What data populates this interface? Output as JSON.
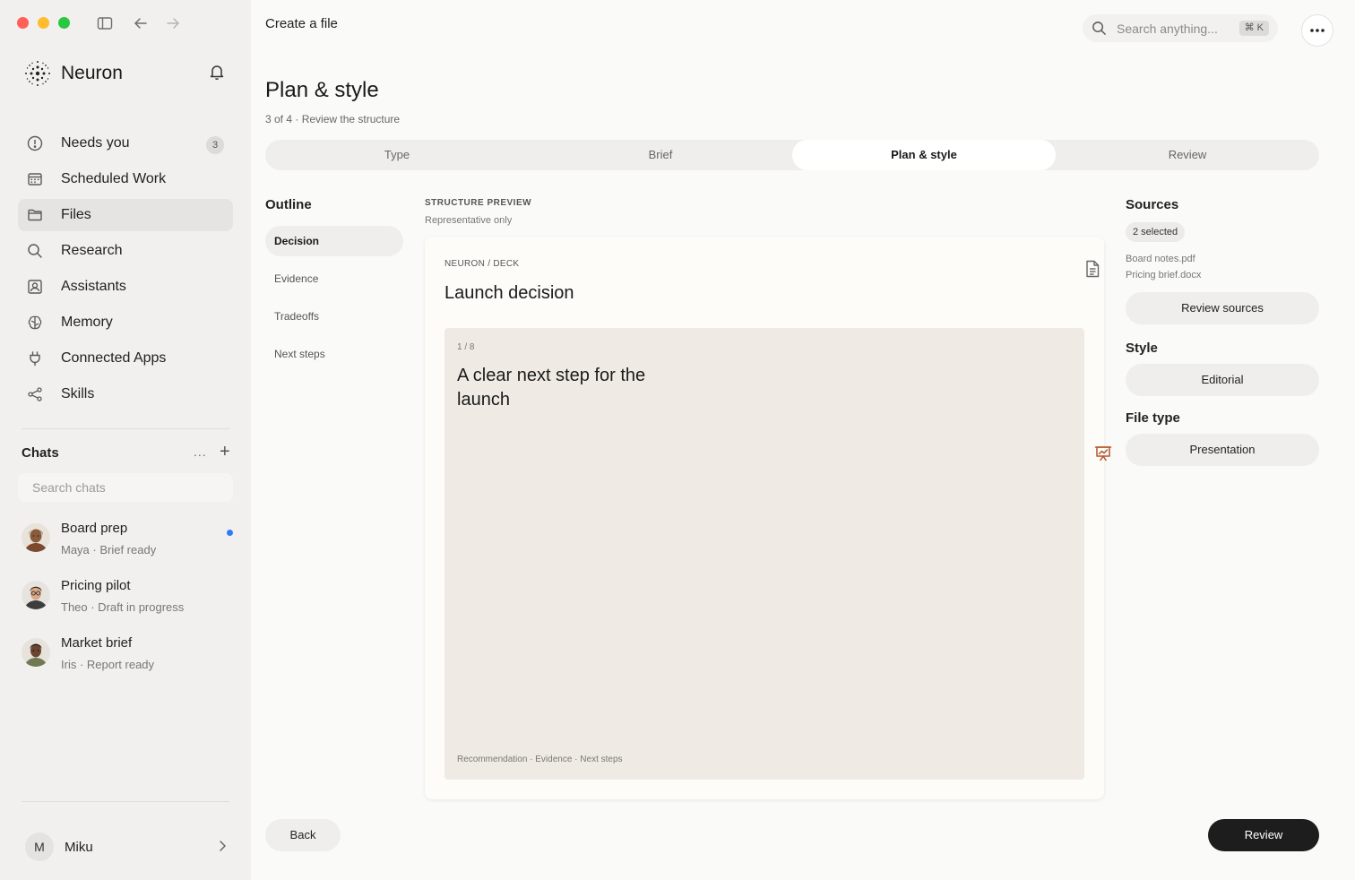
{
  "window": {
    "traffic_lights": {
      "close": "#ff5f57",
      "minimize": "#febc2e",
      "zoom": "#28c840"
    }
  },
  "sidebar": {
    "brand": "Neuron",
    "nav": [
      {
        "label": "Needs you",
        "icon": "alert-circle-icon",
        "badge": "3"
      },
      {
        "label": "Scheduled Work",
        "icon": "calendar-icon"
      },
      {
        "label": "Files",
        "icon": "folder-icon",
        "active": true
      },
      {
        "label": "Research",
        "icon": "search-icon"
      },
      {
        "label": "Assistants",
        "icon": "contact-icon"
      },
      {
        "label": "Memory",
        "icon": "brain-icon"
      },
      {
        "label": "Connected Apps",
        "icon": "plug-icon"
      },
      {
        "label": "Skills",
        "icon": "share-nodes-icon"
      }
    ],
    "chats": {
      "title": "Chats",
      "more": "...",
      "add": "+",
      "search_placeholder": "Search chats",
      "items": [
        {
          "name": "Board prep",
          "subtitle": "Maya · Brief ready",
          "unread": true
        },
        {
          "name": "Pricing pilot",
          "subtitle": "Theo · Draft in progress",
          "unread": false
        },
        {
          "name": "Market brief",
          "subtitle": "Iris · Report ready",
          "unread": false
        }
      ]
    },
    "user": {
      "initial": "M",
      "name": "Miku"
    }
  },
  "header": {
    "title": "Create a file",
    "search_placeholder": "Search anything...",
    "shortcut": "⌘ K"
  },
  "page": {
    "title": "Plan & style",
    "subtitle": "3 of 4 · Review the structure",
    "steps": [
      {
        "label": "Type"
      },
      {
        "label": "Brief"
      },
      {
        "label": "Plan & style",
        "active": true
      },
      {
        "label": "Review"
      }
    ]
  },
  "outline": {
    "title": "Outline",
    "items": [
      {
        "label": "Decision",
        "active": true
      },
      {
        "label": "Evidence"
      },
      {
        "label": "Tradeoffs"
      },
      {
        "label": "Next steps"
      }
    ]
  },
  "preview": {
    "label": "STRUCTURE PREVIEW",
    "sublabel": "Representative only",
    "eyebrow": "NEURON / DECK",
    "title": "Launch decision",
    "slide": {
      "counter": "1 / 8",
      "title": "A clear next step for the launch",
      "footer": "Recommendation · Evidence · Next steps"
    }
  },
  "right_panel": {
    "sources_title": "Sources",
    "sources_chip": "2 selected",
    "files": [
      "Board notes.pdf",
      "Pricing brief.docx"
    ],
    "review_sources_label": "Review sources",
    "style_title": "Style",
    "style_value": "Editorial",
    "filetype_title": "File type",
    "filetype_value": "Presentation"
  },
  "footer": {
    "back_label": "Back",
    "review_label": "Review"
  },
  "colors": {
    "accent_dark": "#1d1d1d",
    "unread_dot": "#2f7cf6",
    "presentation_icon": "#b7552a"
  }
}
